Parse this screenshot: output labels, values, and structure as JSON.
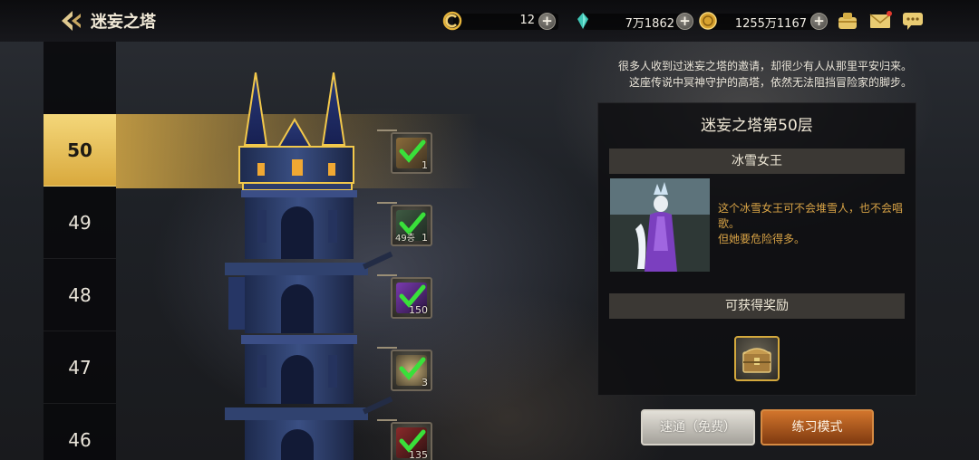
{
  "header": {
    "title": "迷妄之塔",
    "back_icon": "back-arrow-icon"
  },
  "resources": [
    {
      "icon": "gold-c-coin-icon",
      "value": "12"
    },
    {
      "icon": "teal-crystal-icon",
      "value": "7万1862"
    },
    {
      "icon": "gold-coin-icon",
      "value": "1255万1167"
    }
  ],
  "top_icons": [
    "treasure-bag-icon",
    "mail-icon",
    "chat-icon"
  ],
  "floors": [
    {
      "number": "50",
      "active": true
    },
    {
      "number": "49",
      "active": false
    },
    {
      "number": "48",
      "active": false
    },
    {
      "number": "47",
      "active": false
    },
    {
      "number": "46",
      "active": false
    }
  ],
  "floor_rewards": [
    {
      "item": "chest-item",
      "qty": "1",
      "qty_left": "",
      "cleared": true
    },
    {
      "item": "purple-item",
      "qty": "1",
      "qty_left": "49층",
      "cleared": true
    },
    {
      "item": "purple-crystal-item",
      "qty": "150",
      "qty_left": "",
      "cleared": true
    },
    {
      "item": "medal-item",
      "qty": "3",
      "qty_left": "",
      "cleared": true
    },
    {
      "item": "red-crystal-item",
      "qty": "135",
      "qty_left": "",
      "cleared": true
    }
  ],
  "intro": {
    "line1": "很多人收到过迷妄之塔的邀请，却很少有人从那里平安归来。",
    "line2": "这座传说中冥神守护的高塔，依然无法阻挡冒险家的脚步。"
  },
  "panel": {
    "title": "迷妄之塔第50层",
    "boss_name": "冰雪女王",
    "boss_desc_line1": "这个冰雪女王可不会堆雪人，也不会唱歌。",
    "boss_desc_line2": "但她要危险得多。",
    "reward_header": "可获得奖励",
    "reward_icon": "treasure-chest-icon"
  },
  "buttons": {
    "sweep": "速通（免费）",
    "practice": "练习模式"
  },
  "colors": {
    "active_floor": "#e8bf55",
    "boss_desc": "#d8a346",
    "practice_button": "#b55a1f"
  }
}
